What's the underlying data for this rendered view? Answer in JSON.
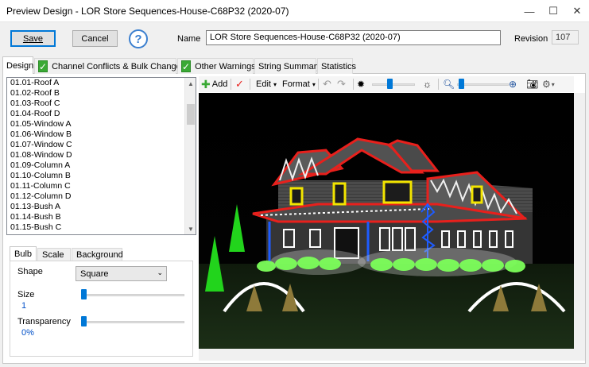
{
  "window": {
    "title": "Preview Design - LOR Store Sequences-House-C68P32 (2020-07)",
    "minimize": "—",
    "maximize": "☐",
    "close": "✕"
  },
  "top": {
    "save_label": "Save",
    "cancel_label": "Cancel",
    "help_label": "?",
    "name_label": "Name",
    "name_value": "LOR Store Sequences-House-C68P32 (2020-07)",
    "revision_label": "Revision",
    "revision_value": "107"
  },
  "tabs": [
    {
      "label": "Design"
    },
    {
      "label": "Channel Conflicts & Bulk Changes",
      "check": "✓"
    },
    {
      "label": "Other Warnings",
      "check": "✓"
    },
    {
      "label": "String Summary"
    },
    {
      "label": "Statistics"
    }
  ],
  "props_list": [
    "01.01-Roof A",
    "01.02-Roof B",
    "01.03-Roof C",
    "01.04-Roof D",
    "01.05-Window A",
    "01.06-Window B",
    "01.07-Window C",
    "01.08-Window D",
    "01.09-Column A",
    "01.10-Column B",
    "01.11-Column C",
    "01.12-Column D",
    "01.13-Bush A",
    "01.14-Bush B",
    "01.15-Bush C"
  ],
  "prop_tabs": [
    "Bulb",
    "Scale",
    "Background"
  ],
  "bulb": {
    "shape_label": "Shape",
    "shape_value": "Square",
    "size_label": "Size",
    "size_value": "1",
    "transparency_label": "Transparency",
    "transparency_value": "0%"
  },
  "toolbar": {
    "add_label": "Add",
    "edit_label": "Edit",
    "format_label": "Format",
    "dropdown_arrow": "▾"
  },
  "colors": {
    "accent": "#0078d7",
    "check_green": "#3aa935",
    "roof_red": "#e8201c",
    "window_yellow": "#f2e400",
    "column_white": "#ffffff",
    "bush_green": "#7cff5a",
    "tree_green": "#22d41c",
    "blue_string": "#1e5cff"
  }
}
